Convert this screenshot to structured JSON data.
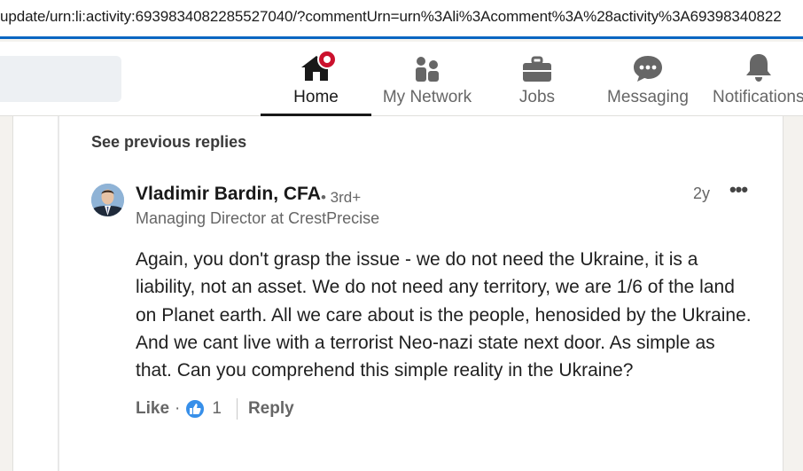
{
  "browser": {
    "url": "update/urn:li:activity:6939834082285527040/?commentUrn=urn%3Ali%3Acomment%3A%28activity%3A69398340822"
  },
  "nav": {
    "items": [
      {
        "label": "Home",
        "icon": "home-icon",
        "active": true,
        "badge": true
      },
      {
        "label": "My Network",
        "icon": "network-icon"
      },
      {
        "label": "Jobs",
        "icon": "briefcase-icon"
      },
      {
        "label": "Messaging",
        "icon": "messaging-icon"
      },
      {
        "label": "Notifications",
        "icon": "bell-icon"
      }
    ]
  },
  "thread": {
    "see_previous": "See previous replies"
  },
  "comment": {
    "author": "Vladimir Bardin, CFA",
    "degree": "• 3rd+",
    "headline": "Managing Director at CrestPrecise",
    "time": "2y",
    "more": "•••",
    "text": "Again, you don't grasp the issue - we do not need the Ukraine, it is a liability, not an asset. We do not need any territory, we are 1/6 of the land on Planet earth. All we care about is the people, henosided by the Ukraine. And we cant live with a terrorist Neo-nazi state next door. As simple as that. Can you comprehend this simple reality in the Ukraine?",
    "like_label": "Like",
    "dot": "·",
    "reaction_count": "1",
    "reply_label": "Reply"
  },
  "colors": {
    "accent": "#0a66c2",
    "badge": "#cb112d",
    "reaction": "#378fe9"
  }
}
